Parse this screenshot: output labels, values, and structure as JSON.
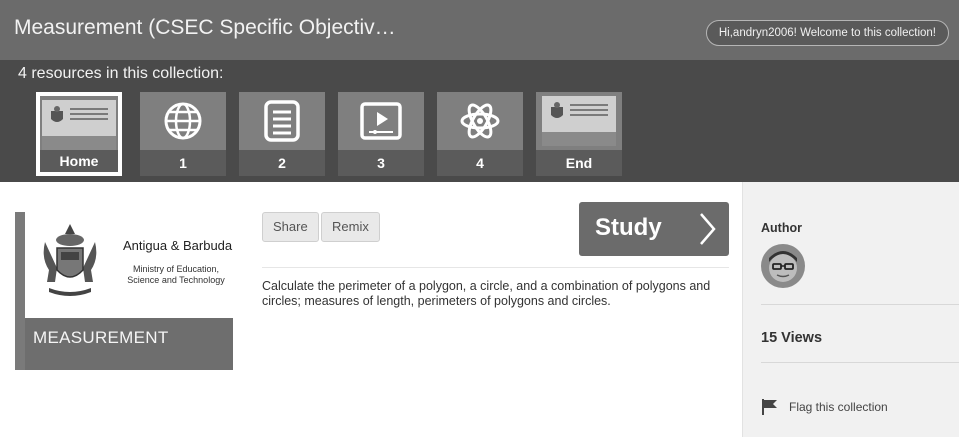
{
  "header": {
    "title": "Measurement (CSEC Specific Objectiv…",
    "welcome": "Hi,andryn2006! Welcome to this collection!"
  },
  "strip": {
    "label": "4 resources in this collection:",
    "tiles": [
      {
        "caption": "Home",
        "icon": "document-cover-thumbnail",
        "selected": true
      },
      {
        "caption": "1",
        "icon": "globe-icon"
      },
      {
        "caption": "2",
        "icon": "text-document-icon"
      },
      {
        "caption": "3",
        "icon": "video-player-icon"
      },
      {
        "caption": "4",
        "icon": "atom-icon"
      },
      {
        "caption": "End",
        "icon": "document-cover-thumbnail"
      }
    ]
  },
  "cover": {
    "country": "Antigua & Barbuda",
    "ministry": "Ministry of Education, Science and Technology",
    "title": "MEASUREMENT"
  },
  "actions": {
    "share": "Share",
    "remix": "Remix",
    "study": "Study"
  },
  "description": "Calculate the perimeter of a polygon, a circle, and a combination of polygons and circles; measures of length, perimeters of polygons and circles.",
  "sidebar": {
    "author_label": "Author",
    "views": "15 Views",
    "flag": "Flag this collection"
  },
  "colors": {
    "header_bg": "#6b6b6b",
    "strip_bg": "#4a4a4a",
    "tile_bg": "#7f7f7f",
    "study_bg": "#6b6b6b",
    "sidebar_bg": "#f1f1f1"
  }
}
